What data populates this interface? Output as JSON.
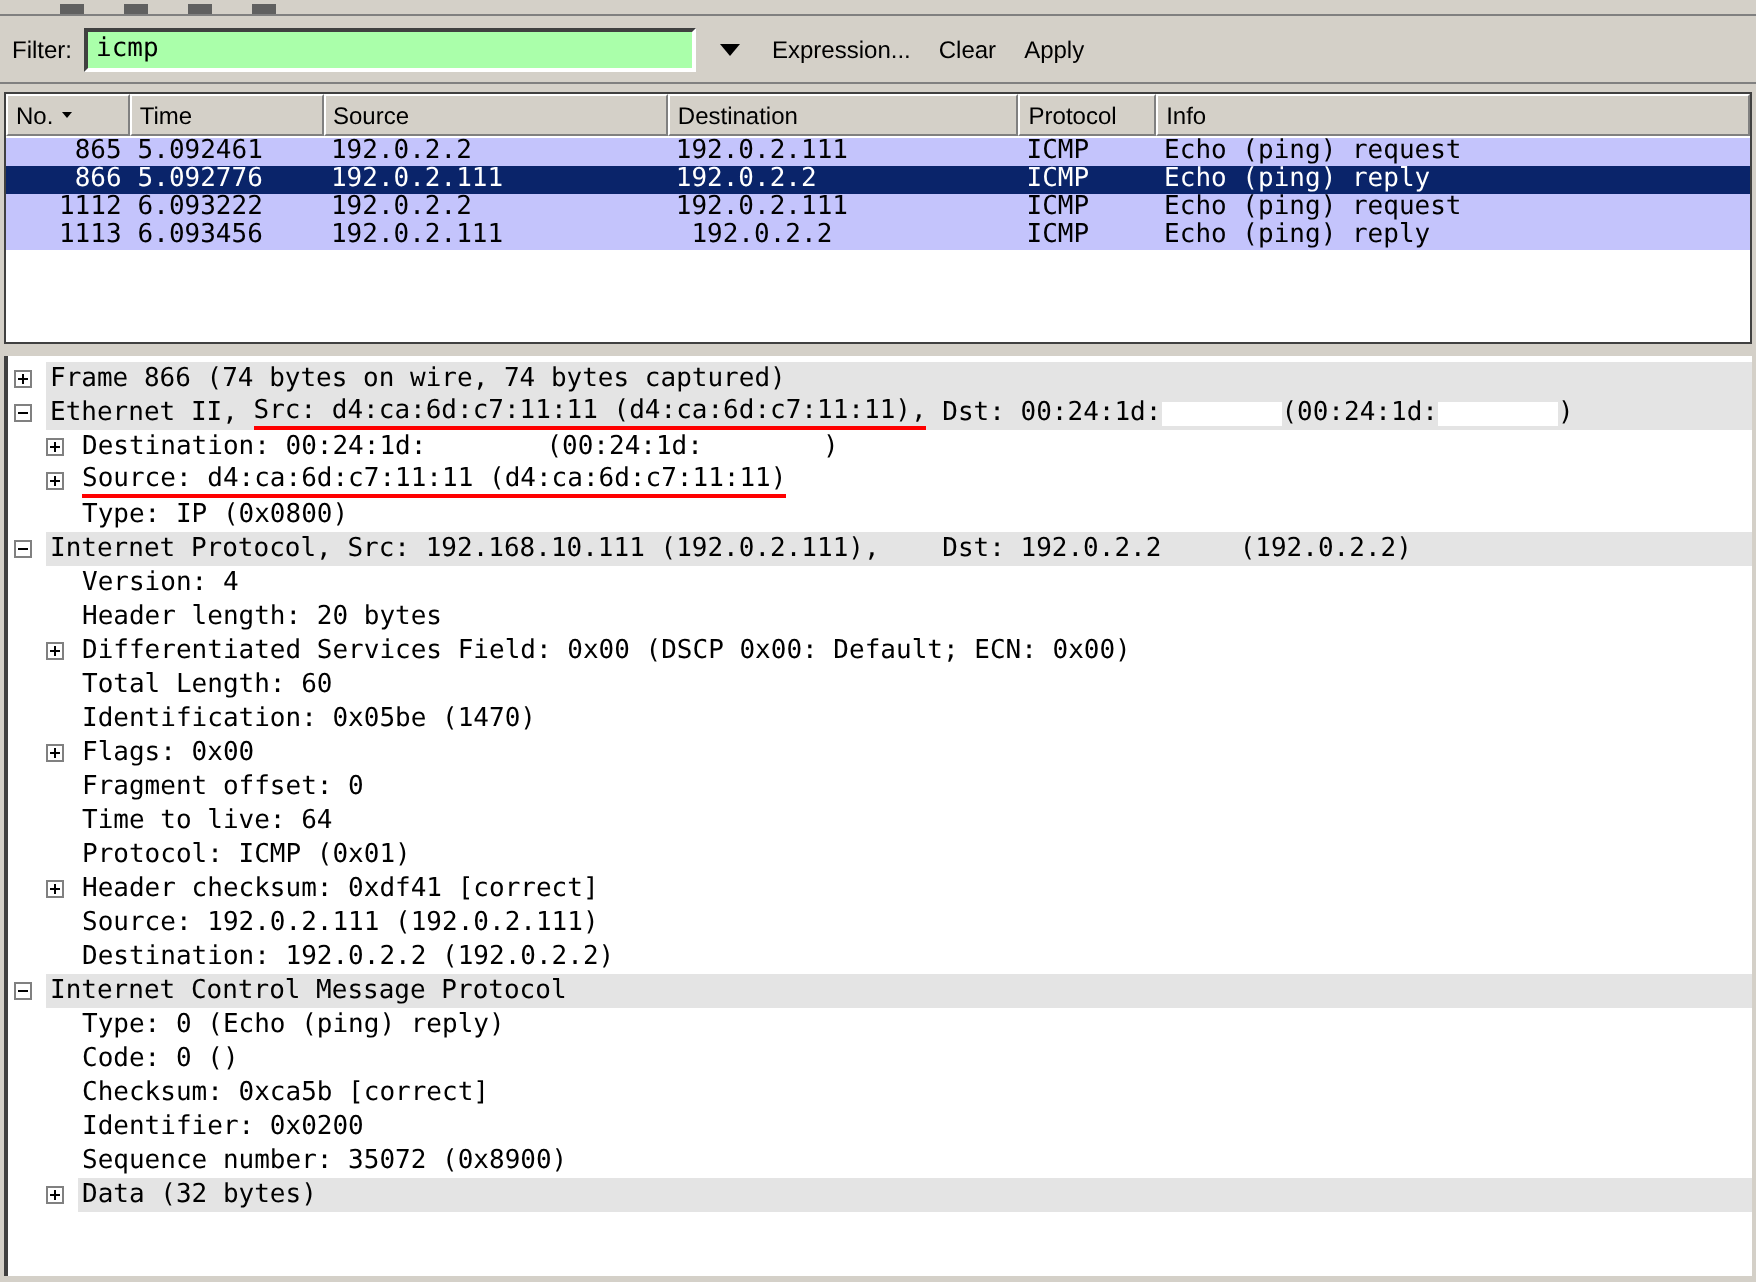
{
  "filter": {
    "label": "Filter:",
    "value": "icmp",
    "buttons": [
      "Expression...",
      "Clear",
      "Apply"
    ]
  },
  "packet_list": {
    "columns": [
      {
        "label": "No.",
        "sorted": true
      },
      {
        "label": "Time",
        "sorted": false
      },
      {
        "label": "Source",
        "sorted": false
      },
      {
        "label": "Destination",
        "sorted": false
      },
      {
        "label": "Protocol",
        "sorted": false
      },
      {
        "label": "Info",
        "sorted": false
      }
    ],
    "rows": [
      {
        "cells": [
          "865",
          "5.092461",
          "192.0.2.2",
          "192.0.2.111",
          "ICMP",
          "Echo (ping) request"
        ],
        "selected": false
      },
      {
        "cells": [
          "866",
          "5.092776",
          "192.0.2.111",
          "192.0.2.2",
          "ICMP",
          "Echo (ping) reply"
        ],
        "selected": true
      },
      {
        "cells": [
          "1112",
          "6.093222",
          "192.0.2.2",
          "192.0.2.111",
          "ICMP",
          "Echo (ping) request"
        ],
        "selected": false
      },
      {
        "cells": [
          "1113",
          "6.093456",
          "192.0.2.111",
          " 192.0.2.2",
          "ICMP",
          "Echo (ping) reply"
        ],
        "selected": false
      }
    ]
  },
  "details": [
    {
      "label": "Frame 866 (74 bytes on wire, 74 bytes captured)",
      "expanded": false,
      "shaded": true
    },
    {
      "segments": [
        {
          "kind": "text",
          "text": "Ethernet II, ",
          "underlined": false
        },
        {
          "kind": "text",
          "text": "Src: d4:ca:6d:c7:11:11 (d4:ca:6d:c7:11:11),",
          "underlined": true
        },
        {
          "kind": "text",
          "text": " Dst: 00:24:1d:",
          "underlined": false
        },
        {
          "kind": "redacted"
        },
        {
          "kind": "text",
          "text": "(00:24:1d:",
          "underlined": false
        },
        {
          "kind": "redacted"
        },
        {
          "kind": "text",
          "text": ")",
          "underlined": false
        }
      ],
      "expanded": true,
      "shaded": true,
      "children": [
        {
          "segments": [
            {
              "kind": "text",
              "text": "Destination: 00:24:1d:",
              "underlined": false
            },
            {
              "kind": "redacted"
            },
            {
              "kind": "text",
              "text": "(00:24:1d:",
              "underlined": false
            },
            {
              "kind": "redacted"
            },
            {
              "kind": "text",
              "text": ")",
              "underlined": false
            }
          ],
          "expanded": false,
          "shaded": false
        },
        {
          "segments": [
            {
              "kind": "text",
              "text": "Source: d4:ca:6d:c7:11:11 (d4:ca:6d:c7:11:11)",
              "underlined": true
            }
          ],
          "expanded": false,
          "shaded": false
        },
        {
          "label": "Type: IP (0x0800)",
          "shaded": false
        }
      ]
    },
    {
      "label": "Internet Protocol, Src: 192.168.10.111 (192.0.2.111),    Dst: 192.0.2.2     (192.0.2.2)",
      "expanded": true,
      "shaded": true,
      "children": [
        {
          "label": "Version: 4",
          "shaded": false
        },
        {
          "label": "Header length: 20 bytes",
          "shaded": false
        },
        {
          "label": "Differentiated Services Field: 0x00 (DSCP 0x00: Default; ECN: 0x00)",
          "expanded": false,
          "shaded": false
        },
        {
          "label": "Total Length: 60",
          "shaded": false
        },
        {
          "label": "Identification: 0x05be (1470)",
          "shaded": false
        },
        {
          "label": "Flags: 0x00",
          "expanded": false,
          "shaded": false
        },
        {
          "label": "Fragment offset: 0",
          "shaded": false
        },
        {
          "label": "Time to live: 64",
          "shaded": false
        },
        {
          "label": "Protocol: ICMP (0x01)",
          "shaded": false
        },
        {
          "label": "Header checksum: 0xdf41 [correct]",
          "expanded": false,
          "shaded": false
        },
        {
          "label": "Source: 192.0.2.111 (192.0.2.111)",
          "shaded": false
        },
        {
          "label": "Destination: 192.0.2.2 (192.0.2.2)",
          "shaded": false
        }
      ]
    },
    {
      "label": "Internet Control Message Protocol",
      "expanded": true,
      "shaded": true,
      "children": [
        {
          "label": "Type: 0 (Echo (ping) reply)",
          "shaded": false
        },
        {
          "label": "Code: 0 ()",
          "shaded": false
        },
        {
          "label": "Checksum: 0xca5b [correct]",
          "shaded": false
        },
        {
          "label": "Identifier: 0x0200",
          "shaded": false
        },
        {
          "label": "Sequence number: 35072 (0x8900)",
          "shaded": false
        },
        {
          "label": "Data (32 bytes)",
          "expanded": false,
          "shaded": true
        }
      ]
    }
  ]
}
